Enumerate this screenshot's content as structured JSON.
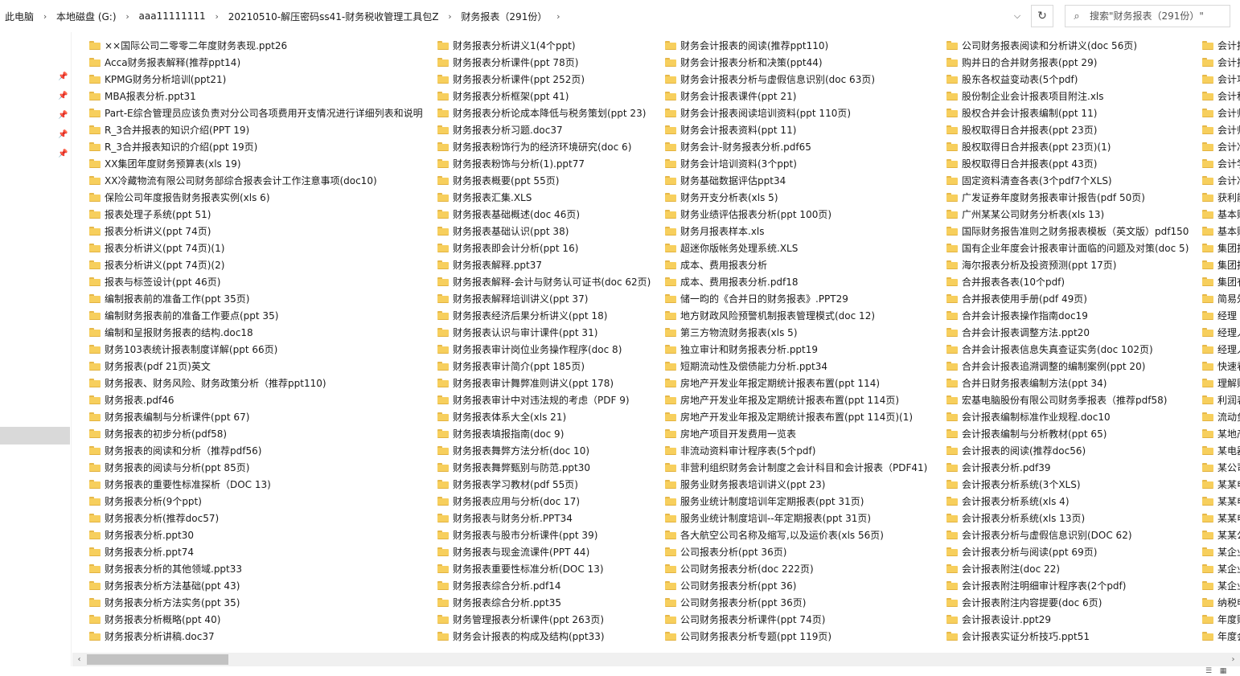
{
  "address_bar": {
    "crumbs": [
      "此电脑",
      "本地磁盘 (G:)",
      "aaa11111111",
      "20210510-解压密码ss41-财务税收管理工具包Z",
      "财务报表（291份）"
    ]
  },
  "search": {
    "placeholder": "搜索\"财务报表（291份）\""
  },
  "icons": {
    "separator": "chevron-right-icon",
    "dropdown": "chevron-down-icon",
    "refresh": "refresh-icon",
    "search": "search-icon",
    "pin": "pin-icon",
    "folder": "folder-icon"
  },
  "colors": {
    "folder": "#f7cf5d",
    "selection": "#d9d9d9"
  },
  "columns": [
    [
      "××国际公司二零零二年度财务表现.ppt26",
      "Acca财务报表解释(推荐ppt14)",
      "KPMG财务分析培训(ppt21)",
      "MBA报表分析.ppt31",
      "Part-E综合管理员应该负责对分公司各项费用开支情况进行详细列表和说明",
      "R_3合并报表的知识介绍(PPT 19)",
      "R_3合并报表知识的介绍(ppt 19页)",
      "XX集团年度财务预算表(xls 19)",
      "XX冷藏物流有限公司财务部综合报表会计工作注意事项(doc10)",
      "保险公司年度报告财务报表实例(xls 6)",
      "报表处理子系统(ppt 51)",
      "报表分析讲义(ppt 74页)",
      "报表分析讲义(ppt 74页)(1)",
      "报表分析讲义(ppt 74页)(2)",
      "报表与标签设计(ppt 46页)",
      "编制报表前的准备工作(ppt 35页)",
      "编制财务报表前的准备工作要点(ppt 35)",
      "编制和呈报财务报表的结构.doc18",
      "财务103表统计报表制度详解(ppt 66页)",
      "财务报表(pdf 21页)英文",
      "财务报表、财务风险、财务政策分析（推荐ppt110)",
      "财务报表.pdf46",
      "财务报表编制与分析课件(ppt 67)",
      "财务报表的初步分析(pdf58)",
      "财务报表的阅读和分析（推荐pdf56)",
      "财务报表的阅读与分析(ppt 85页)",
      "财务报表的重要性标准探析（DOC 13)",
      "财务报表分析(9个ppt)",
      "财务报表分析(推荐doc57)",
      "财务报表分析.ppt30",
      "财务报表分析.ppt74",
      "财务报表分析的其他领域.ppt33",
      "财务报表分析方法基础(ppt 43)",
      "财务报表分析方法实务(ppt 35)",
      "财务报表分析概略(ppt 40)",
      "财务报表分析讲稿.doc37"
    ],
    [
      "财务报表分析讲义1(4个ppt)",
      "财务报表分析课件(ppt 78页)",
      "财务报表分析课件(ppt 252页)",
      "财务报表分析框架(ppt 41)",
      "财务报表分析论成本降低与税务策划(ppt 23)",
      "财务报表分析习题.doc37",
      "财务报表粉饰行为的经济环境研究(doc 6)",
      "财务报表粉饰与分析(1).ppt77",
      "财务报表概要(ppt 55页)",
      "财务报表汇集.XLS",
      "财务报表基础概述(doc 46页)",
      "财务报表基础认识(ppt 38)",
      "财务报表即会计分析(ppt 16)",
      "财务报表解释.ppt37",
      "财务报表解释-会计与财务认可证书(doc 62页)",
      "财务报表解释培训讲义(ppt 37)",
      "财务报表经济后果分析讲义(ppt 18)",
      "财务报表认识与审计课件(ppt 31)",
      "财务报表审计岗位业务操作程序(doc 8)",
      "财务报表审计简介(ppt 185页)",
      "财务报表审计舞弊准则讲义(ppt 178)",
      "财务报表审计中对违法规的考虑（PDF 9)",
      "财务报表体系大全(xls 21)",
      "财务报表填报指南(doc 9)",
      "财务报表舞弊方法分析(doc 10)",
      "财务报表舞弊甄别与防范.ppt30",
      "财务报表学习教材(pdf 55页)",
      "财务报表应用与分析(doc 17)",
      "财务报表与财务分析.PPT34",
      "财务报表与股市分析课件(ppt 39)",
      "财务报表与现金流课件(PPT 44)",
      "财务报表重要性标准分析(DOC 13)",
      "财务报表综合分析.pdf14",
      "财务报表综合分析.ppt35",
      "财务管理报表分析课件(ppt 263页)",
      "财务会计报表的构成及结构(ppt33)"
    ],
    [
      "财务会计报表的阅读(推荐ppt110)",
      "财务会计报表分析和决策(ppt44)",
      "财务会计报表分析与虚假信息识别(doc 63页)",
      "财务会计报表课件(ppt 21)",
      "财务会计报表阅读培训资料(ppt 110页)",
      "财务会计报表资料(ppt 11)",
      "财务会计-财务报表分析.pdf65",
      "财务会计培训资料(3个ppt)",
      "财务基础数据评估ppt34",
      "财务开支分析表(xls 5)",
      "财务业绩评估报表分析(ppt 100页)",
      "财务月报表样本.xls",
      "超迷你版帐务处理系统.XLS",
      "成本、费用报表分析",
      "成本、费用报表分析.pdf18",
      "储一昀的《合并日的财务报表》.PPT29",
      "地方财政风险预警机制报表管理模式(doc 12)",
      "第三方物流财务报表(xls 5)",
      "独立审计和财务报表分析.ppt19",
      "短期流动性及偿债能力分析.ppt34",
      "房地产开发业年报定期统计报表布置(ppt 114)",
      "房地产开发业年报及定期统计报表布置(ppt 114页)",
      "房地产开发业年报及定期统计报表布置(ppt 114页)(1)",
      "房地产项目开发费用一览表",
      "非流动资料审计程序表(5个pdf)",
      "非营利组织财务会计制度之会计科目和会计报表（PDF41)",
      "服务业财务报表培训讲义(ppt 23)",
      "服务业统计制度培训年定期报表(ppt 31页)",
      "服务业统计制度培训--年定期报表(ppt 31页)",
      "各大航空公司名称及缩写,以及运价表(xls 56页)",
      "公司报表分析(ppt 36页)",
      "公司财务报表分析(doc 222页)",
      "公司财务报表分析(ppt 36)",
      "公司财务报表分析(ppt 36页)",
      "公司财务报表分析课件(ppt 74页)",
      "公司财务报表分析专题(ppt 119页)"
    ],
    [
      "公司财务报表阅读和分析讲义(doc 56页)",
      "购并日的合并财务报表(ppt 29)",
      "股东各权益变动表(5个pdf)",
      "股份制企业会计报表项目附注.xls",
      "股权合并会计报表编制(ppt 11)",
      "股权取得日合并报表(ppt 23页)",
      "股权取得日合并报表(ppt 23页)(1)",
      "股权取得日合并报表(ppt 43页)",
      "固定资料清查各表(3个pdf7个XLS)",
      "广发证券年度财务报表审计报告(pdf 50页)",
      "广州某某公司财务分析表(xls 13)",
      "国际财务报告准则之财务报表模板（英文版）pdf150",
      "国有企业年度会计报表审计面临的问题及对策(doc 5)",
      "海尔报表分析及投资预测(ppt 17页)",
      "合并报表各表(10个pdf)",
      "合并报表使用手册(pdf 49页)",
      "合并会计报表操作指南doc19",
      "合并会计报表调整方法.ppt20",
      "合并会计报表信息失真查证实务(doc 102页)",
      "合并会计报表追溯调整的编制案例(ppt 20)",
      "合并日财务报表编制方法(ppt 34)",
      "宏基电脑股份有限公司财务季报表（推荐pdf58)",
      "会计报表编制标准作业规程.doc10",
      "会计报表编制与分析教材(ppt 65)",
      "会计报表的阅读(推荐doc56)",
      "会计报表分析.pdf39",
      "会计报表分析系统(3个XLS)",
      "会计报表分析系统(xls 4)",
      "会计报表分析系统(xls 13页)",
      "会计报表分析与虚假信息识别(DOC 62)",
      "会计报表分析与阅读(ppt 69页)",
      "会计报表附注(doc 22)",
      "会计报表附注明细审计程序表(2个pdf)",
      "会计报表附注内容提要(doc 6页)",
      "会计报表设计.ppt29",
      "会计报表实证分析技巧.ppt51"
    ],
    [
      "会计报",
      "会计报",
      "会计功",
      "会计科",
      "会计师",
      "会计师",
      "会计准",
      "会计学",
      "会计准",
      "获利能",
      "基本财",
      "基本财",
      "集团报",
      "集团报",
      "集团有",
      "简易外",
      "经理",
      "经理人",
      "经理人",
      "快速看",
      "理解财",
      "利润表",
      "流动负",
      "某地产",
      "某电器",
      "某公司",
      "某某电",
      "某某电",
      "某某电",
      "某某公",
      "某企业",
      "某企业",
      "某企业",
      "纳税申",
      "年度财",
      "年度会"
    ]
  ],
  "view": {
    "details_icon": "details-view-icon",
    "large_icon": "large-icons-view-icon"
  }
}
